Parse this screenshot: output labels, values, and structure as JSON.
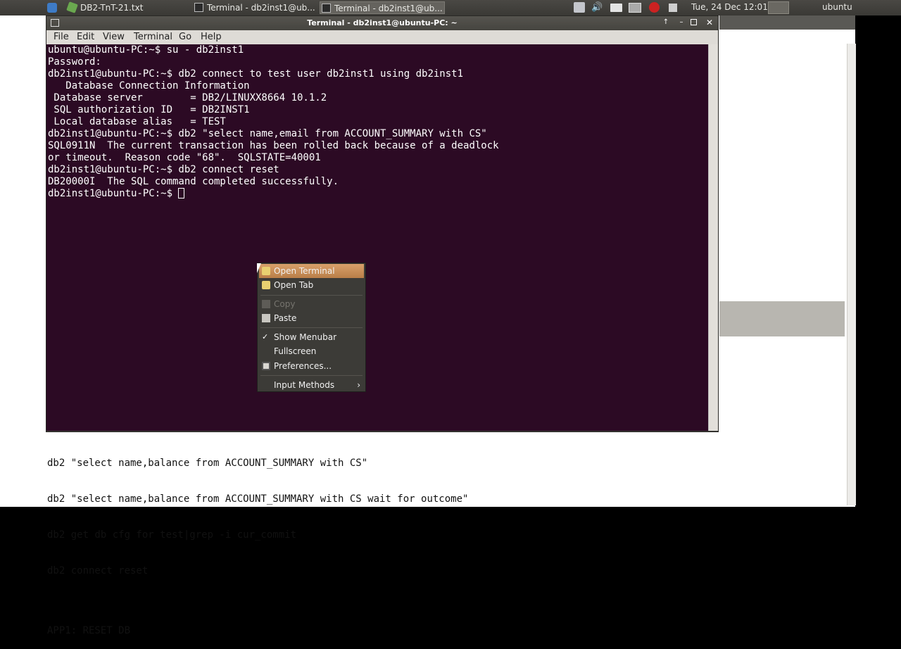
{
  "top_panel": {
    "tasks": [
      {
        "label": "DB2-TnT-21.txt"
      },
      {
        "label": "Terminal - db2inst1@ub..."
      },
      {
        "label": "Terminal - db2inst1@ub..."
      }
    ],
    "clock": "Tue, 24 Dec 12:01",
    "user": "ubuntu"
  },
  "terminal": {
    "title": "Terminal - db2inst1@ubuntu-PC: ~",
    "menu": [
      "File",
      "Edit",
      "View",
      "Terminal",
      "Go",
      "Help"
    ],
    "lines": [
      "ubuntu@ubuntu-PC:~$ su - db2inst1",
      "Password:",
      "db2inst1@ubuntu-PC:~$ db2 connect to test user db2inst1 using db2inst1",
      "",
      "   Database Connection Information",
      "",
      " Database server        = DB2/LINUXX8664 10.1.2",
      " SQL authorization ID   = DB2INST1",
      " Local database alias   = TEST",
      "",
      "db2inst1@ubuntu-PC:~$ db2 \"select name,email from ACCOUNT_SUMMARY with CS\"",
      "SQL0911N  The current transaction has been rolled back because of a deadlock",
      "or timeout.  Reason code \"68\".  SQLSTATE=40001",
      "db2inst1@ubuntu-PC:~$ db2 connect reset",
      "DB20000I  The SQL command completed successfully."
    ],
    "prompt": "db2inst1@ubuntu-PC:~$ "
  },
  "context_menu": {
    "items": [
      {
        "label": "Open Terminal",
        "icon": "terminal-icon"
      },
      {
        "label": "Open Tab",
        "icon": "tab-icon"
      },
      {
        "label": "Copy",
        "icon": "copy-icon"
      },
      {
        "label": "Paste",
        "icon": "paste-icon"
      },
      {
        "label": "Show Menubar",
        "icon": "check-icon"
      },
      {
        "label": "Fullscreen"
      },
      {
        "label": "Preferences...",
        "icon": "preferences-icon"
      },
      {
        "label": "Input Methods",
        "icon": "chevron-right-icon"
      }
    ]
  },
  "background_doc": {
    "lines": [
      "db2 \"select name,balance from ACCOUNT_SUMMARY with CS\"",
      "db2 \"select name,balance from ACCOUNT_SUMMARY with CS wait for outcome\"",
      "db2 get db cfg for test|grep -i cur_commit",
      "db2 connect reset",
      "",
      "APP1: RESET DB"
    ]
  },
  "colors": {
    "terminal_bg": "#2c0a24",
    "menu_highlight": "#c98e58",
    "panel_bg": "#3f3e3a"
  }
}
